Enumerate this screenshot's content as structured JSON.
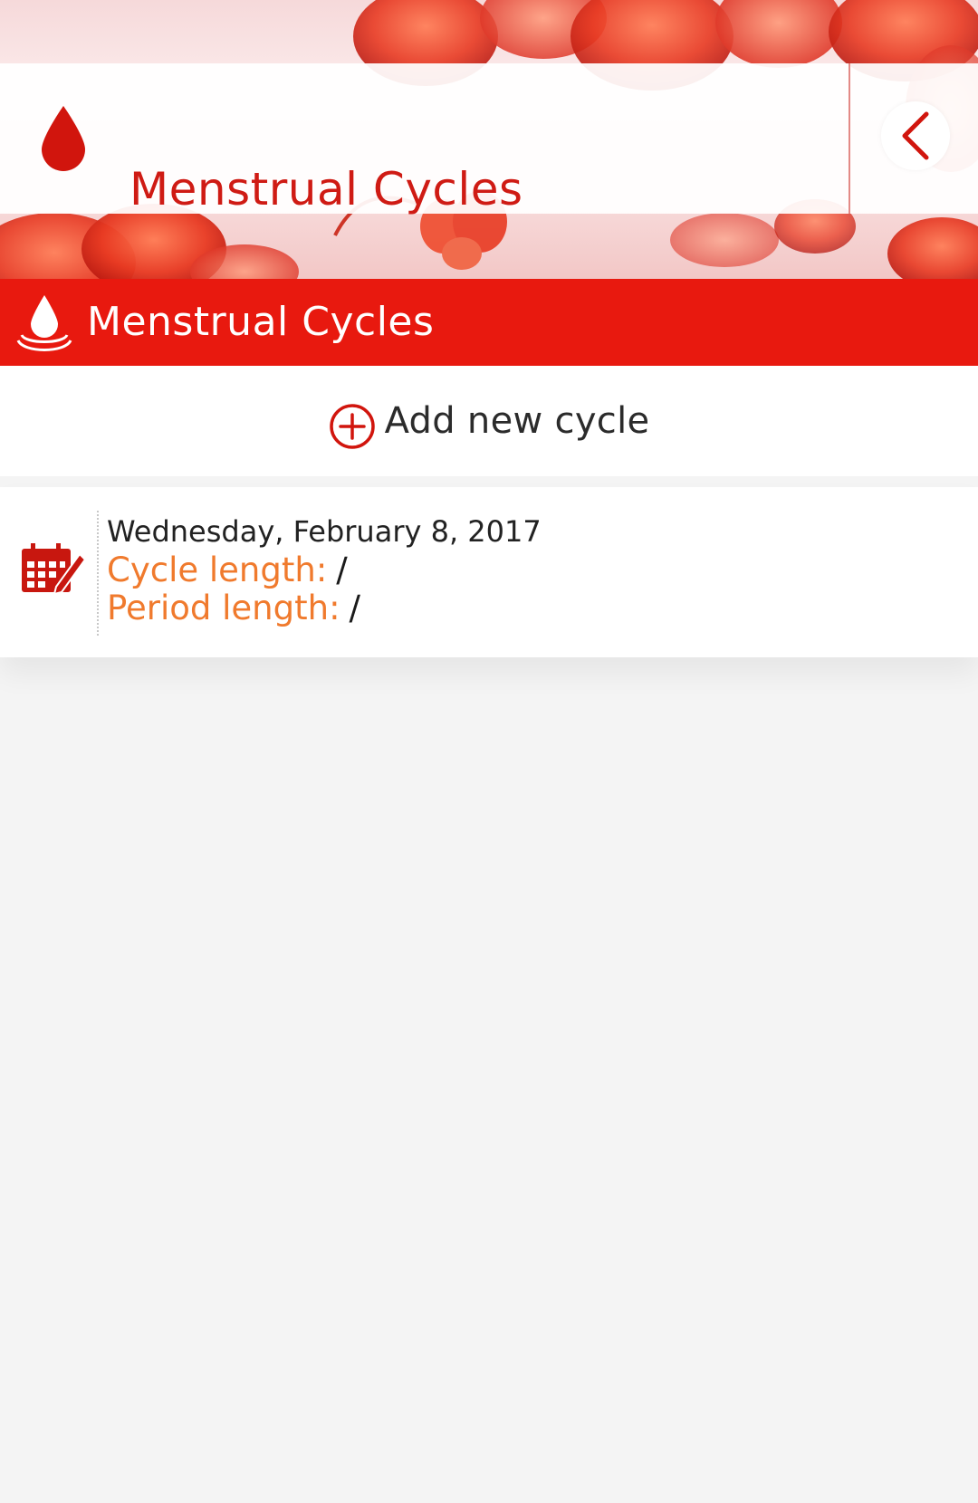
{
  "app_bar": {
    "title": "Menstrual Cycles",
    "leading_icon": "blood-drop-icon",
    "back_icon": "chevron-left-icon"
  },
  "section": {
    "title": "Menstrual Cycles",
    "icon": "water-drop-icon"
  },
  "add_row": {
    "label": "Add new cycle",
    "icon": "plus-circle-icon"
  },
  "cycles": [
    {
      "date": "Wednesday, February 8, 2017",
      "cycle_label": "Cycle length:",
      "cycle_value": "/",
      "period_label": "Period length:",
      "period_value": "/",
      "icon": "calendar-edit-icon"
    }
  ],
  "colors": {
    "accent_red": "#e8190f",
    "title_red": "#cf1b14",
    "label_orange": "#f07a2d",
    "background": "#f4f4f4"
  }
}
